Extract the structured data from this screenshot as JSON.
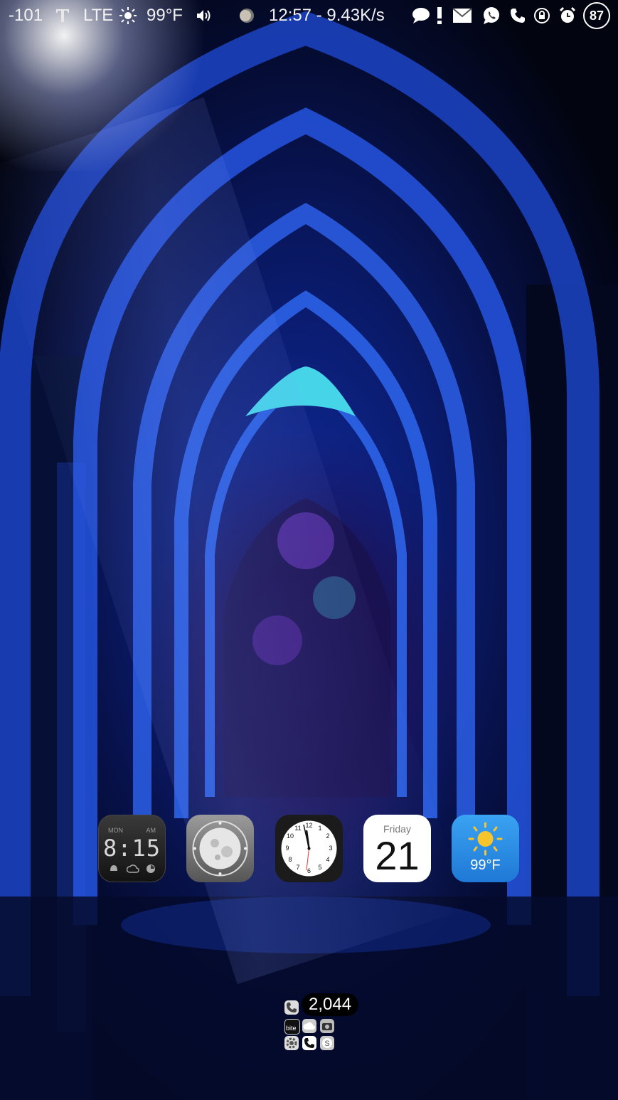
{
  "status_bar": {
    "signal": "-101",
    "carrier_icon": "t-mobile-logo-icon",
    "network": "LTE",
    "weather_icon": "sun-icon",
    "temperature": "99°F",
    "volume_icon": "speaker-icon",
    "moon_icon": "moon-phase-icon",
    "time_speed": "12:57 - 9.43K/s",
    "notification_icons": [
      "chat-bubble-icon",
      "alert-icon",
      "mail-icon",
      "whatsapp-icon",
      "phone-icon",
      "rotation-lock-icon",
      "alarm-icon"
    ],
    "battery": "87"
  },
  "widgets": {
    "digital_clock": {
      "time": "8:15",
      "day": "MON",
      "ampm": "AM"
    },
    "moon_phase": {
      "icon": "moon-icon"
    },
    "analog_clock": {
      "icon": "analog-clock-icon"
    },
    "calendar": {
      "day": "Friday",
      "date": "21"
    },
    "weather": {
      "icon": "sun-icon",
      "temperature": "99°F"
    }
  },
  "folder": {
    "badge": "2,044",
    "apps": [
      "phone-icon",
      "bite-icon",
      "cloud-icon",
      "camera-icon",
      "settings-icon",
      "dialer-icon",
      "skype-icon"
    ],
    "bite_label": "bite"
  },
  "colors": {
    "background": "#020414",
    "weather_blue": "#2a8fe6",
    "sun_yellow": "#f7c42c"
  }
}
